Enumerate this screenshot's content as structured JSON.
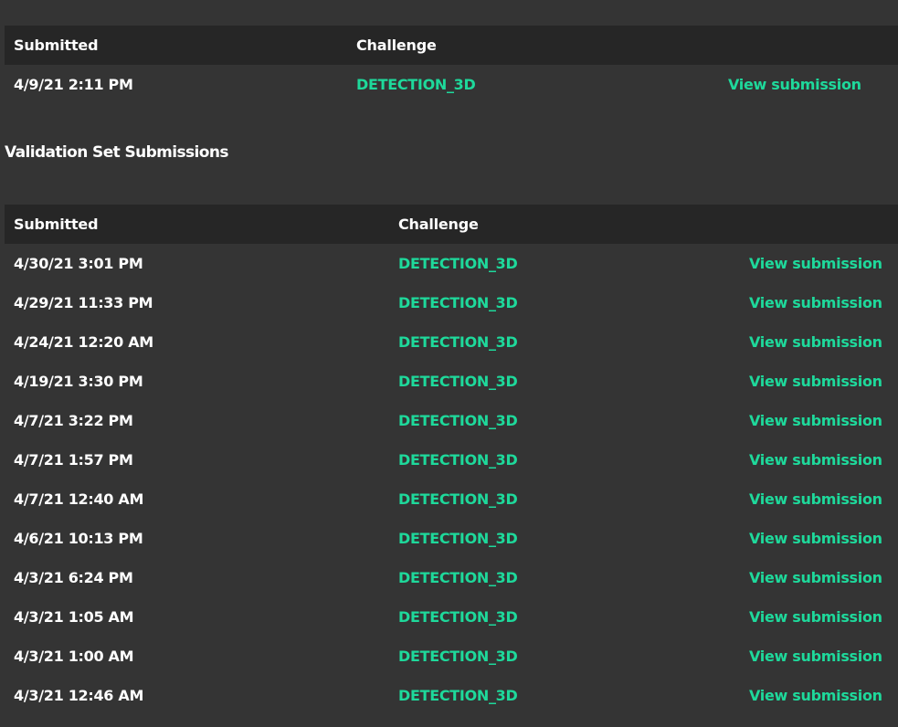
{
  "test_table": {
    "headers": {
      "submitted": "Submitted",
      "challenge": "Challenge"
    },
    "rows": [
      {
        "submitted": "4/9/21 2:11 PM",
        "challenge": "DETECTION_3D",
        "action": "View submission"
      }
    ]
  },
  "validation_section": {
    "title": "Validation Set Submissions"
  },
  "validation_table": {
    "headers": {
      "submitted": "Submitted",
      "challenge": "Challenge"
    },
    "rows": [
      {
        "submitted": "4/30/21 3:01 PM",
        "challenge": "DETECTION_3D",
        "action": "View submission"
      },
      {
        "submitted": "4/29/21 11:33 PM",
        "challenge": "DETECTION_3D",
        "action": "View submission"
      },
      {
        "submitted": "4/24/21 12:20 AM",
        "challenge": "DETECTION_3D",
        "action": "View submission"
      },
      {
        "submitted": "4/19/21 3:30 PM",
        "challenge": "DETECTION_3D",
        "action": "View submission"
      },
      {
        "submitted": "4/7/21 3:22 PM",
        "challenge": "DETECTION_3D",
        "action": "View submission"
      },
      {
        "submitted": "4/7/21 1:57 PM",
        "challenge": "DETECTION_3D",
        "action": "View submission"
      },
      {
        "submitted": "4/7/21 12:40 AM",
        "challenge": "DETECTION_3D",
        "action": "View submission"
      },
      {
        "submitted": "4/6/21 10:13 PM",
        "challenge": "DETECTION_3D",
        "action": "View submission"
      },
      {
        "submitted": "4/3/21 6:24 PM",
        "challenge": "DETECTION_3D",
        "action": "View submission"
      },
      {
        "submitted": "4/3/21 1:05 AM",
        "challenge": "DETECTION_3D",
        "action": "View submission"
      },
      {
        "submitted": "4/3/21 1:00 AM",
        "challenge": "DETECTION_3D",
        "action": "View submission"
      },
      {
        "submitted": "4/3/21 12:46 AM",
        "challenge": "DETECTION_3D",
        "action": "View submission"
      }
    ]
  },
  "colors": {
    "background": "#343434",
    "header_background": "#262626",
    "accent_green": "#1ed99b",
    "text": "#ffffff"
  }
}
